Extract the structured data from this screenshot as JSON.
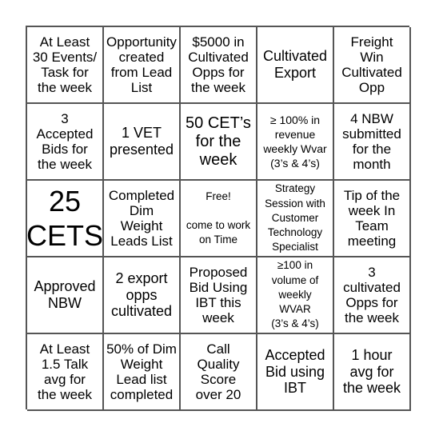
{
  "board": {
    "cells": [
      {
        "text": "At Least\n30 Events/\nTask for\nthe week",
        "size": "s-n"
      },
      {
        "text": "Opportunity\ncreated\nfrom Lead\nList",
        "size": "s-n"
      },
      {
        "text": "$5000 in\nCultivated\nOpps for\nthe week",
        "size": "s-n"
      },
      {
        "text": "Cultivated\nExport",
        "size": "s-m"
      },
      {
        "text": "Freight\nWin\nCultivated\nOpp",
        "size": "s-n"
      },
      {
        "text": "3\nAccepted\nBids for\nthe week",
        "size": "s-n"
      },
      {
        "text": "1 VET\npresented",
        "size": "s-m"
      },
      {
        "text": "50 CET’s\nfor the\nweek",
        "size": "s-l"
      },
      {
        "text": "≥ 100% in\nrevenue\nweekly Wvar\n(3’s & 4’s)",
        "size": "s-sm"
      },
      {
        "text": "4 NBW\nsubmitted\nfor the\nmonth",
        "size": "s-n"
      },
      {
        "text": "25\nCETS",
        "size": "s-xl"
      },
      {
        "text": "Completed\nDim\nWeight\nLeads List",
        "size": "s-n"
      },
      {
        "text": "Free!\n\ncome to work\non Time",
        "size": "s-xs"
      },
      {
        "text": "Strategy\nSession with\nCustomer\nTechnology\nSpecialist",
        "size": "s-xs"
      },
      {
        "text": "Tip of the\nweek In\nTeam\nmeeting",
        "size": "s-n"
      },
      {
        "text": "Approved\nNBW",
        "size": "s-m"
      },
      {
        "text": "2 export\nopps\ncultivated",
        "size": "s-m"
      },
      {
        "text": "Proposed\nBid Using\nIBT this\nweek",
        "size": "s-n"
      },
      {
        "text": "≥100 in\nvolume of\nweekly\nWVAR\n(3’s & 4’s)",
        "size": "s-xs"
      },
      {
        "text": "3\ncultivated\nOpps for\nthe week",
        "size": "s-n"
      },
      {
        "text": "At Least\n1.5 Talk\navg for\nthe week",
        "size": "s-n"
      },
      {
        "text": "50% of Dim\nWeight\nLead list\ncompleted",
        "size": "s-n"
      },
      {
        "text": "Call\nQuality\nScore\nover 20",
        "size": "s-n"
      },
      {
        "text": "Accepted\nBid using\nIBT",
        "size": "s-m"
      },
      {
        "text": "1 hour\navg for\nthe week",
        "size": "s-m"
      }
    ]
  }
}
